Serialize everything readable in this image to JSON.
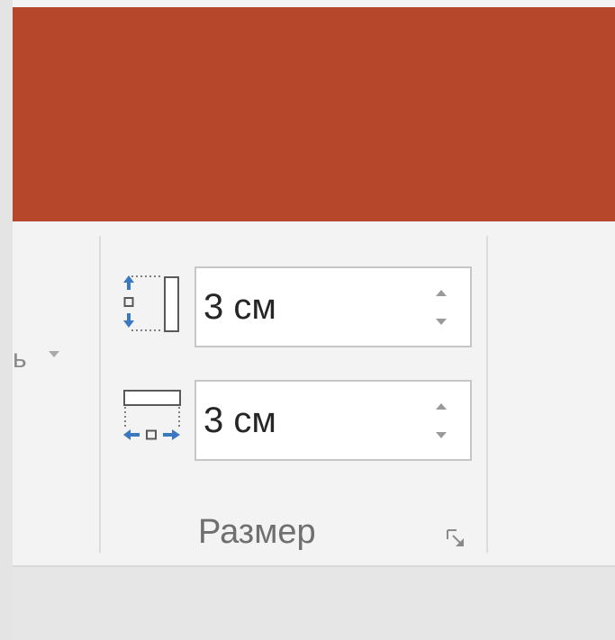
{
  "ribbon": {
    "truncated_label": "ь",
    "size_group": {
      "label": "Размер",
      "height_value": "3 см",
      "width_value": "3 см",
      "height_icon": "shape-height-icon",
      "width_icon": "shape-width-icon",
      "launcher_icon": "dialog-launcher-icon"
    }
  },
  "colors": {
    "titlebar": "#b7472a",
    "ribbon_bg": "#f3f3f3",
    "icon_blue": "#3a78c2",
    "text": "#262626",
    "group_label": "#6f6f6f"
  }
}
